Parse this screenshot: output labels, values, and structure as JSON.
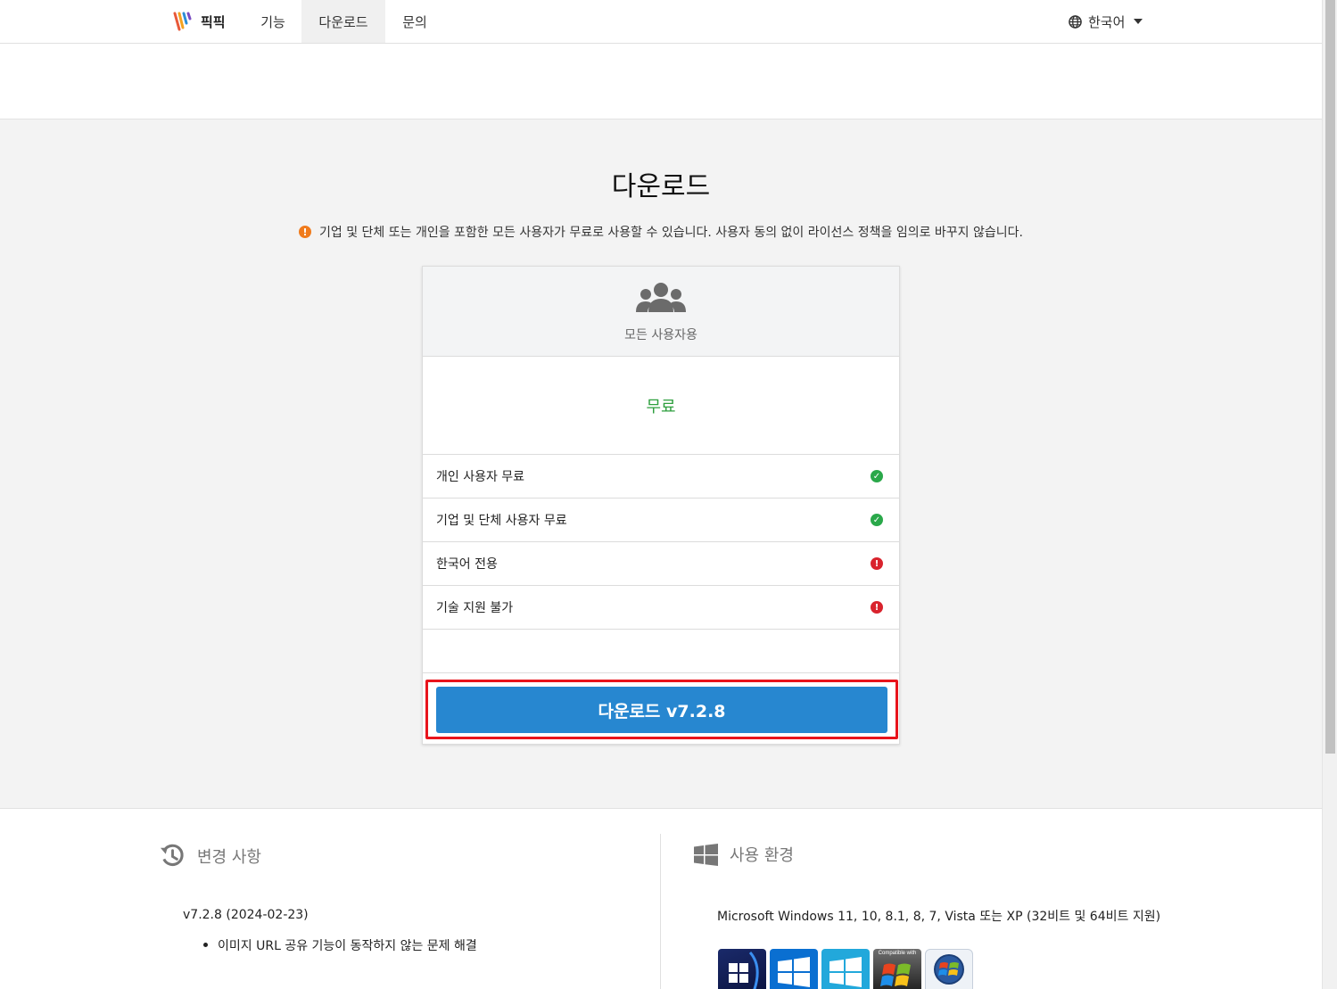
{
  "nav": {
    "brand": "픽픽",
    "items": [
      {
        "label": "기능"
      },
      {
        "label": "다운로드"
      },
      {
        "label": "문의"
      }
    ],
    "language": "한국어"
  },
  "main": {
    "title": "다운로드",
    "notice": "기업 및 단체 또는 개인을 포함한 모든 사용자가 무료로 사용할 수 있습니다. 사용자 동의 없이 라이선스 정책을 임의로 바꾸지 않습니다.",
    "card": {
      "plan_label": "모든 사용자용",
      "price": "무료",
      "features": [
        {
          "label": "개인 사용자 무료",
          "status": "ok"
        },
        {
          "label": "기업 및 단체 사용자 무료",
          "status": "ok"
        },
        {
          "label": "한국어 전용",
          "status": "no"
        },
        {
          "label": "기술 지원 불가",
          "status": "no"
        }
      ],
      "download_label": "다운로드 v7.2.8"
    }
  },
  "changelog": {
    "heading": "변경 사항",
    "version_line": "v7.2.8 (2024-02-23)",
    "items": [
      "이미지 URL 공유 기능이 동작하지 않는 문제 해결"
    ]
  },
  "environment": {
    "heading": "사용 환경",
    "line": "Microsoft Windows 11, 10, 8.1, 8, 7, Vista 또는 XP (32비트 및 64비트 지원)",
    "badges": [
      {
        "icon": "windows-11-badge-icon"
      },
      {
        "icon": "windows-10-badge-icon"
      },
      {
        "icon": "windows-8-badge-icon"
      },
      {
        "icon": "windows-7-compatible-badge-icon",
        "label": "Compatible with"
      },
      {
        "icon": "windows-vista-badge-icon"
      }
    ]
  },
  "colors": {
    "accent": "#2787d0",
    "ok": "#2aa84a",
    "no": "#d9232d",
    "warn": "#f07b1c",
    "highlight": "#e8141c"
  }
}
